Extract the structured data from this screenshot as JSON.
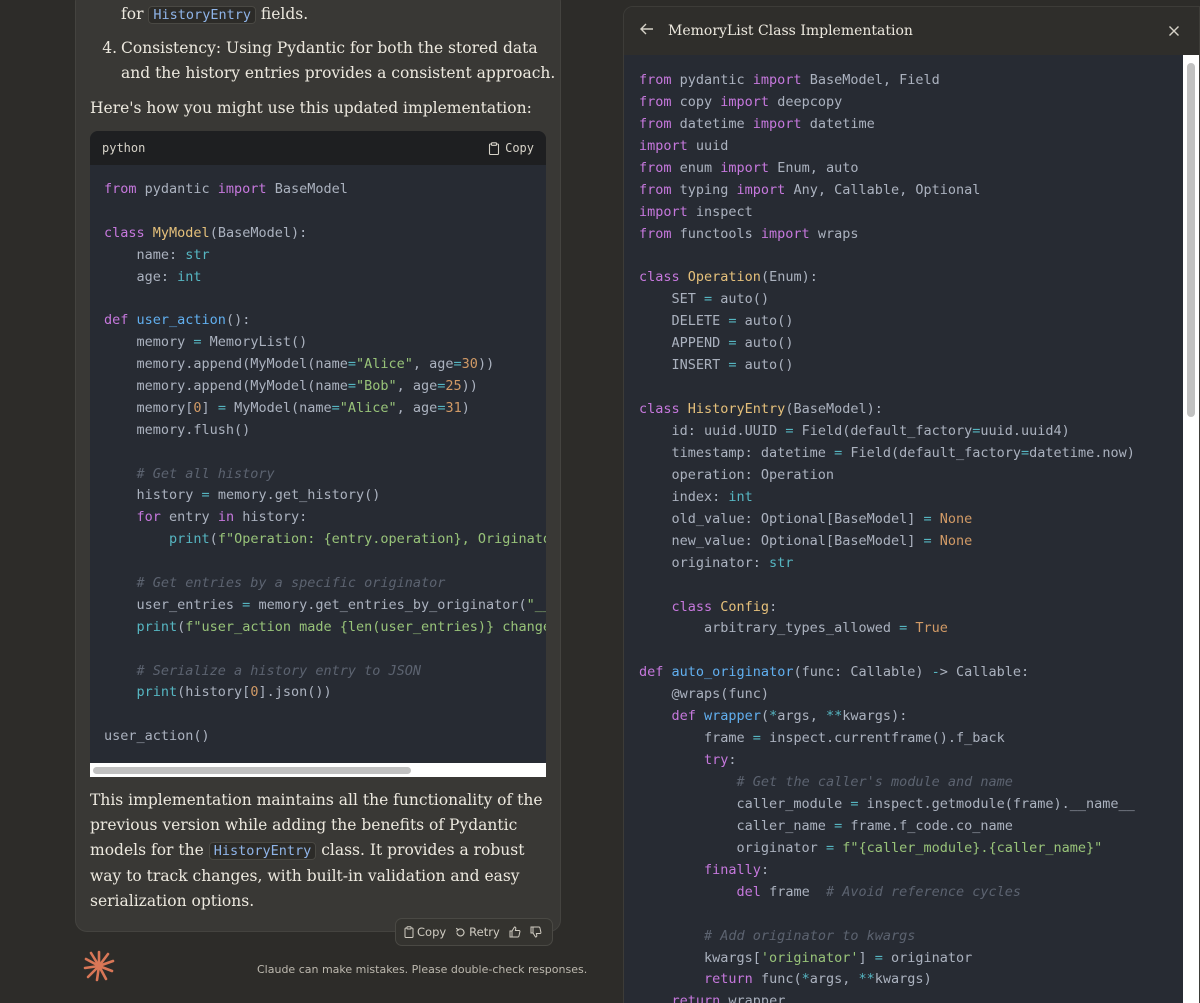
{
  "chat": {
    "intro_for": "for",
    "intro_code": "HistoryEntry",
    "intro_rest": "fields.",
    "item4_num": "4.",
    "item4_line1": "Consistency: Using Pydantic for both the stored data",
    "item4_line2": "and the history entries provides a consistent approach.",
    "usage_intro": "Here's how you might use this updated implementation:",
    "code_lang": "python",
    "copy_label": "Copy",
    "code_lines": [
      "from pydantic import BaseModel",
      "",
      "class MyModel(BaseModel):",
      "    name: str",
      "    age: int",
      "",
      "def user_action():",
      "    memory = MemoryList()",
      "    memory.append(MyModel(name=\"Alice\", age=30))",
      "    memory.append(MyModel(name=\"Bob\", age=25))",
      "    memory[0] = MyModel(name=\"Alice\", age=31)",
      "    memory.flush()",
      "",
      "    # Get all history",
      "    history = memory.get_history()",
      "    for entry in history:",
      "        print(f\"Operation: {entry.operation}, Originator",
      "",
      "    # Get entries by a specific originator",
      "    user_entries = memory.get_entries_by_originator(\"__m",
      "    print(f\"user_action made {len(user_entries)} changes",
      "",
      "    # Serialize a history entry to JSON",
      "    print(history[0].json())",
      "",
      "user_action()"
    ],
    "summary_p1_line1": "This implementation maintains all the functionality of the",
    "summary_p1_line2": "previous version while adding the benefits of Pydantic",
    "summary_p1_line3a": "models for the",
    "summary_p1_code": "HistoryEntry",
    "summary_p1_line3b": "class. It provides a robust",
    "summary_p1_line4": "way to track changes, with built-in validation and easy",
    "summary_p1_line5": "serialization options.",
    "actions": {
      "copy": "Copy",
      "retry": "Retry"
    },
    "disclaimer": "Claude can make mistakes. Please double-check responses."
  },
  "artifact": {
    "title": "MemoryList Class Implementation",
    "code_lines": [
      "from pydantic import BaseModel, Field",
      "from copy import deepcopy",
      "from datetime import datetime",
      "import uuid",
      "from enum import Enum, auto",
      "from typing import Any, Callable, Optional",
      "import inspect",
      "from functools import wraps",
      "",
      "class Operation(Enum):",
      "    SET = auto()",
      "    DELETE = auto()",
      "    APPEND = auto()",
      "    INSERT = auto()",
      "",
      "class HistoryEntry(BaseModel):",
      "    id: uuid.UUID = Field(default_factory=uuid.uuid4)",
      "    timestamp: datetime = Field(default_factory=datetime.now)",
      "    operation: Operation",
      "    index: int",
      "    old_value: Optional[BaseModel] = None",
      "    new_value: Optional[BaseModel] = None",
      "    originator: str",
      "",
      "    class Config:",
      "        arbitrary_types_allowed = True",
      "",
      "def auto_originator(func: Callable) -> Callable:",
      "    @wraps(func)",
      "    def wrapper(*args, **kwargs):",
      "        frame = inspect.currentframe().f_back",
      "        try:",
      "            # Get the caller's module and name",
      "            caller_module = inspect.getmodule(frame).__name__",
      "            caller_name = frame.f_code.co_name",
      "            originator = f\"{caller_module}.{caller_name}\"",
      "        finally:",
      "            del frame  # Avoid reference cycles",
      "",
      "        # Add originator to kwargs",
      "        kwargs['originator'] = originator",
      "        return func(*args, **kwargs)",
      "    return wrapper"
    ]
  },
  "colors": {
    "keyword": "#c678dd",
    "function": "#61afef",
    "string": "#98c379",
    "comment": "#5c6370",
    "type": "#e5c07b",
    "number": "#d19a66",
    "brand_logo": "#d97757"
  },
  "icons": [
    "clipboard-icon",
    "back-arrow-icon",
    "close-icon",
    "retry-icon",
    "thumbs-up-icon",
    "thumbs-down-icon",
    "claude-logo"
  ]
}
